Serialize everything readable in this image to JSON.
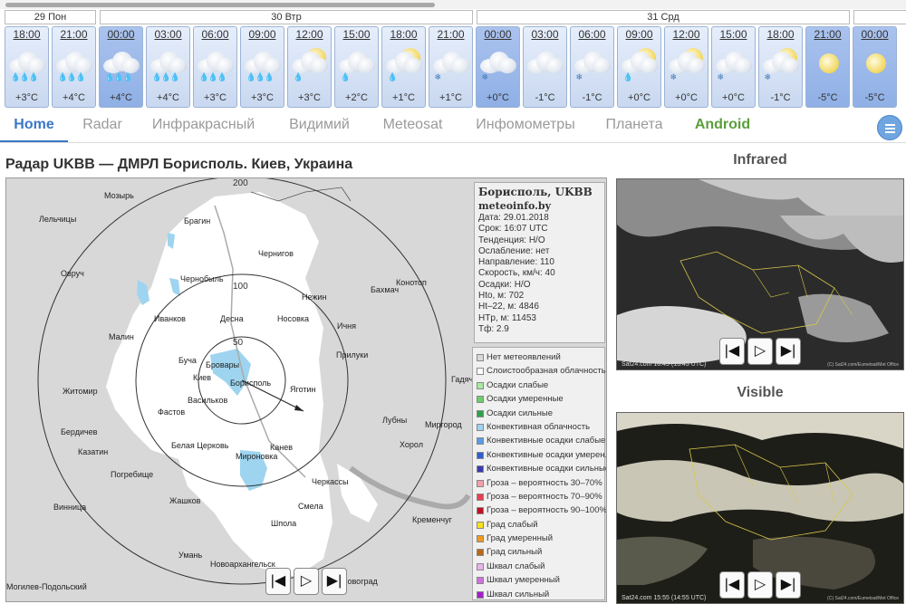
{
  "days": [
    "29 Пон",
    "30 Втр",
    "31 Срд"
  ],
  "forecast": [
    {
      "time": "18:00",
      "temp": "+3°C",
      "icon": "cloud-rain-icon",
      "precip": "💧💧💧"
    },
    {
      "time": "21:00",
      "temp": "+4°C",
      "icon": "cloud-rain-icon",
      "precip": "💧💧💧"
    },
    {
      "time": "00:00",
      "temp": "+4°C",
      "icon": "cloud-rain-icon",
      "precip": "💧💧💧"
    },
    {
      "time": "03:00",
      "temp": "+4°C",
      "icon": "cloud-rain-icon",
      "precip": "💧💧💧"
    },
    {
      "time": "06:00",
      "temp": "+3°C",
      "icon": "cloud-rain-icon",
      "precip": "💧💧💧"
    },
    {
      "time": "09:00",
      "temp": "+3°C",
      "icon": "cloud-rain-icon",
      "precip": "💧💧💧"
    },
    {
      "time": "12:00",
      "temp": "+3°C",
      "icon": "sun-cloud-rain-icon",
      "precip": "💧"
    },
    {
      "time": "15:00",
      "temp": "+2°C",
      "icon": "cloud-rain-icon",
      "precip": "💧"
    },
    {
      "time": "18:00",
      "temp": "+1°C",
      "icon": "sun-cloud-rain-icon",
      "precip": "💧"
    },
    {
      "time": "21:00",
      "temp": "+1°C",
      "icon": "cloud-snow-icon",
      "precip": "❄"
    },
    {
      "time": "00:00",
      "temp": "+0°C",
      "icon": "cloud-snow-icon",
      "precip": "❄"
    },
    {
      "time": "03:00",
      "temp": "-1°C",
      "icon": "cloud-icon",
      "precip": ""
    },
    {
      "time": "06:00",
      "temp": "-1°C",
      "icon": "cloud-snow-icon",
      "precip": "❄"
    },
    {
      "time": "09:00",
      "temp": "+0°C",
      "icon": "sun-cloud-rain-icon",
      "precip": "💧"
    },
    {
      "time": "12:00",
      "temp": "+0°C",
      "icon": "sun-cloud-snow-icon",
      "precip": "❄"
    },
    {
      "time": "15:00",
      "temp": "+0°C",
      "icon": "cloud-snow-icon",
      "precip": "❄"
    },
    {
      "time": "18:00",
      "temp": "-1°C",
      "icon": "sun-cloud-snow-icon",
      "precip": "❄"
    },
    {
      "time": "21:00",
      "temp": "-5°C",
      "icon": "moon-icon",
      "precip": ""
    },
    {
      "time": "00:00",
      "temp": "-5°C",
      "icon": "moon-icon",
      "precip": ""
    }
  ],
  "nav": {
    "tabs": [
      "Home",
      "Radar",
      "Инфракрасный",
      "Видимий",
      "Meteosat",
      "Инфомометры",
      "Планета",
      "Android"
    ],
    "active": "Home"
  },
  "page": {
    "title": "Радар UKBB — ДМРЛ Борисполь. Киев, Украина"
  },
  "radar": {
    "header": "Борисполь, UKBB",
    "site": "meteoinfo.by",
    "info": [
      "Дата: 29.01.2018",
      "Срок: 16:07 UTC",
      "Тенденция: Н/О",
      "Ослабление: нет",
      "Направление: 110",
      "Скорость, км/ч: 40",
      "Осадки: Н/О",
      "Hto, м: 702",
      "Ht–22, м: 4846",
      "HTp, м: 11453",
      "Тф: 2.9"
    ],
    "rings": [
      "50",
      "100",
      "200"
    ],
    "cities": [
      "Мозырь",
      "Брагин",
      "Лельчицы",
      "Чернигов",
      "Овруч",
      "Чернобыль",
      "Конотоп",
      "Бахмач",
      "Нежин",
      "Иванков",
      "Десна",
      "Носовка",
      "Ичня",
      "Малин",
      "Прилуки",
      "Буча",
      "Бровары",
      "Киев",
      "Борисполь",
      "Яготин",
      "Житомир",
      "Васильков",
      "Фастов",
      "Гадяч",
      "Лубны",
      "Миргород",
      "Бердичев",
      "Белая Церковь",
      "Канев",
      "Хорол",
      "Казатин",
      "Погребище",
      "Мироновка",
      "Черкассы",
      "Жашков",
      "Смела",
      "Винница",
      "Шпола",
      "Кременчуг",
      "Умань",
      "Новоархангельск",
      "Могилев-Подольский",
      "Новоград"
    ],
    "legend": [
      {
        "label": "Нет метеоявлений",
        "color": "#d8d8d8"
      },
      {
        "label": "Слоистообразная облачность",
        "color": "#ffffff"
      },
      {
        "label": "Осадки слабые",
        "color": "#a8eaa0"
      },
      {
        "label": "Осадки умеренные",
        "color": "#6ccf6a"
      },
      {
        "label": "Осадки сильные",
        "color": "#2ea24a"
      },
      {
        "label": "Конвективная облачность",
        "color": "#9ed4ef"
      },
      {
        "label": "Конвективные осадки слабые",
        "color": "#5a9ce6"
      },
      {
        "label": "Конвективные осадки умерен.",
        "color": "#2f5fd0"
      },
      {
        "label": "Конвективные осадки сильные",
        "color": "#3a3ab0"
      },
      {
        "label": "Гроза – вероятность 30–70%",
        "color": "#f4a0a8"
      },
      {
        "label": "Гроза – вероятность 70–90%",
        "color": "#e84050"
      },
      {
        "label": "Гроза – вероятность 90–100%",
        "color": "#c01020"
      },
      {
        "label": "Град слабый",
        "color": "#f8e020"
      },
      {
        "label": "Град умеренный",
        "color": "#f09a20"
      },
      {
        "label": "Град сильный",
        "color": "#b86818"
      },
      {
        "label": "Шквал слабый",
        "color": "#e8b4ec"
      },
      {
        "label": "Шквал умеренный",
        "color": "#d070e0"
      },
      {
        "label": "Шквал сильный",
        "color": "#a020c8"
      }
    ]
  },
  "player": {
    "prev": "|◀",
    "play": "▷",
    "next": "▶|"
  },
  "infrared": {
    "title": "Infrared",
    "caption": "Sat24.com 16:45 (15:45 UTC)",
    "credit": "(C) Sat24.com/Eumetsat/Met Office"
  },
  "visible": {
    "title": "Visible",
    "caption": "Sat24.com 15:55 (14:55 UTC)",
    "credit": "(C) Sat24.com/Eumetsat/Met Office"
  }
}
